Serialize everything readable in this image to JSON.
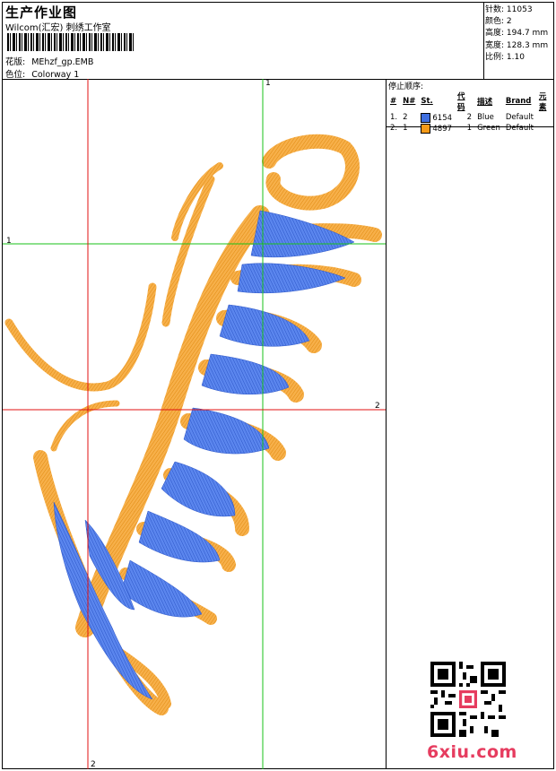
{
  "header": {
    "title": "生产作业图",
    "subtitle": "Wilcom(汇宏) 刺绣工作室",
    "design_label": "花版:",
    "design_value": "MEhzf_gp.EMB",
    "colorway_label": "色位:",
    "colorway_value": "Colorway 1"
  },
  "stats": [
    {
      "label": "针数:",
      "value": "11053"
    },
    {
      "label": "颜色:",
      "value": "2"
    },
    {
      "label": "高度:",
      "value": "194.7 mm"
    },
    {
      "label": "宽度:",
      "value": "128.3 mm"
    },
    {
      "label": "比例:",
      "value": "1.10"
    }
  ],
  "sequence": {
    "title": "停止顺序:",
    "headers": [
      "#",
      "N#",
      "St.",
      "代码",
      "描述",
      "Brand",
      "元素"
    ],
    "rows": [
      {
        "num": "1.",
        "n": "2",
        "swatch": "#3f6fe0",
        "st": "6154",
        "code": "2",
        "desc": "Blue",
        "brand": "Default"
      },
      {
        "num": "2.",
        "n": "1",
        "swatch": "#f59a17",
        "st": "4897",
        "code": "1",
        "desc": "Green",
        "brand": "Default"
      }
    ]
  },
  "guides": {
    "green_v_top": "1",
    "green_h_left": "1",
    "red_h_right": "2",
    "red_v_bottom": "2"
  },
  "colors": {
    "blue_thread": "#3f6fe0",
    "orange_thread": "#f59a17",
    "guide_green": "#19c219",
    "guide_red": "#e01010",
    "logo": "#e63c5f"
  },
  "watermark": {
    "logo_text": "6xiu.com",
    "qr_icon": "qr-code-icon"
  }
}
